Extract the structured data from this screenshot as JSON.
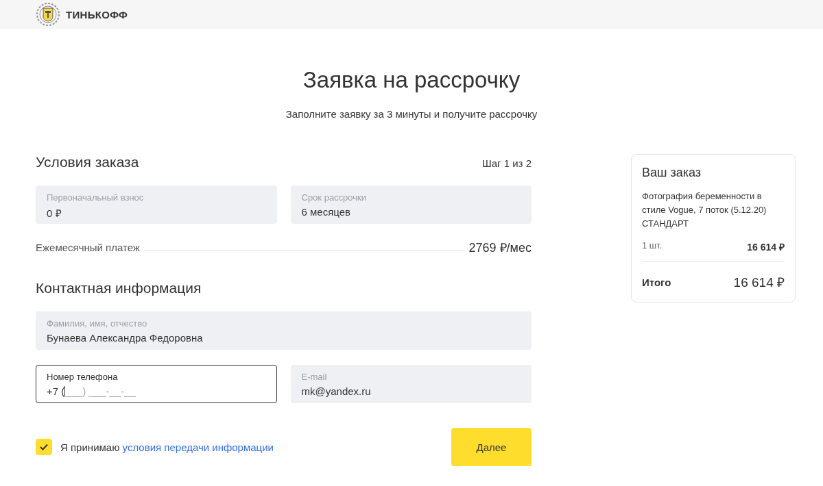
{
  "header": {
    "brand": "ТИНЬКОФФ"
  },
  "title": "Заявка на рассрочку",
  "subtitle": "Заполните заявку за 3 минуты и получите рассрочку",
  "order_conditions": {
    "heading": "Условия заказа",
    "step": "Шаг 1 из 2",
    "fields": [
      {
        "label": "Первоначальный взнос",
        "value": "0 ₽",
        "focused": false
      },
      {
        "label": "Срок рассрочки",
        "value": "6 месяцев",
        "focused": false
      }
    ],
    "monthly": {
      "label": "Ежемесячный платеж",
      "value": "2769 ₽/мес"
    }
  },
  "contact": {
    "heading": "Контактная информация",
    "full_name": {
      "label": "Фамилия, имя, отчество",
      "value": "Бунаева Александра Федоровна",
      "focused": false
    },
    "fields": [
      {
        "label": "Номер телефона",
        "value": "+7 (",
        "placeholder": "___) ___-__-__",
        "focused": true
      },
      {
        "label": "E-mail",
        "value": "mk@yandex.ru",
        "focused": false
      }
    ]
  },
  "consent": {
    "checked": true,
    "text": "Я принимаю",
    "link": "условия передачи информации"
  },
  "next_button": "Далее",
  "order": {
    "heading": "Ваш заказ",
    "item": "Фотография беременности в стиле Vogue, 7 поток (5.12.20) СТАНДАРТ",
    "quantity": "1 шт.",
    "price": "16 614 ₽",
    "total_label": "Итого",
    "total": "16 614 ₽"
  }
}
